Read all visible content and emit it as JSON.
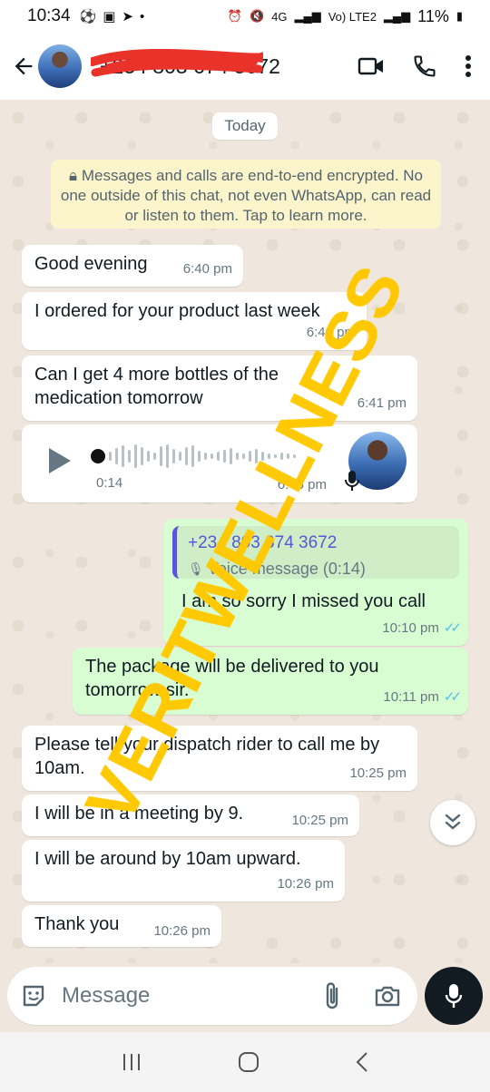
{
  "status_bar": {
    "time": "10:34",
    "network": "4G",
    "sim2": "Vo) LTE2",
    "battery": "11%"
  },
  "header": {
    "contact_number": "+234 803 674 3672"
  },
  "chat": {
    "date_chip": "Today",
    "encryption_notice": "Messages and calls are end-to-end encrypted. No one outside of this chat, not even WhatsApp, can read or listen to them. Tap to learn more.",
    "messages": [
      {
        "text": "Good evening",
        "time": "6:40 pm"
      },
      {
        "text": "I ordered for your product last week",
        "time": "6:40 pm"
      },
      {
        "text": "Can I get 4 more bottles of the medication tomorrow",
        "time": "6:41 pm"
      },
      {
        "type": "voice",
        "duration": "0:14",
        "time": "6:46 pm"
      },
      {
        "quote_author": "+234 803 674 3672",
        "quote_body": "Voice message (0:14)",
        "text": "I am so sorry I missed you call",
        "time": "10:10 pm"
      },
      {
        "text": "The package will be delivered to you tomorrow sir.",
        "time": "10:11 pm"
      },
      {
        "text": "Please tell your dispatch rider to call me by 10am.",
        "time": "10:25 pm"
      },
      {
        "text": "I will be in a meeting by 9.",
        "time": "10:25 pm"
      },
      {
        "text": "I will be around by 10am upward.",
        "time": "10:26 pm"
      },
      {
        "text": "Thank you",
        "time": "10:26 pm"
      }
    ]
  },
  "watermark": "VERITWELLNESS",
  "composer": {
    "placeholder": "Message"
  },
  "icons": {
    "back": "arrow-left-icon",
    "video": "video-camera-icon",
    "call": "phone-icon",
    "menu": "kebab-menu-icon",
    "emoji": "sticker-icon",
    "attach": "paperclip-icon",
    "camera": "camera-icon",
    "mic": "microphone-icon"
  },
  "colors": {
    "incoming": "#ffffff",
    "outgoing": "#d9fdd3",
    "read_ticks": "#53bdeb",
    "notice": "#fcf4cb",
    "watermark": "#ffc800"
  }
}
